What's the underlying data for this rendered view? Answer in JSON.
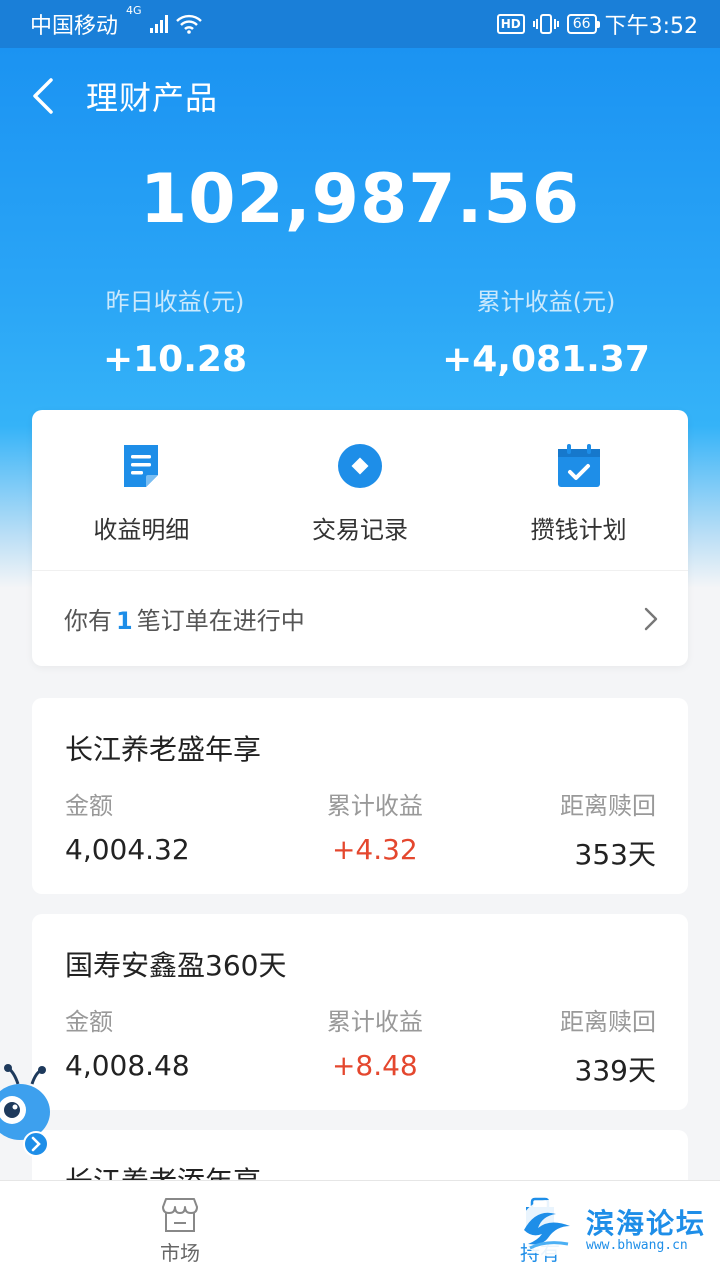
{
  "status_bar": {
    "carrier": "中国移动",
    "network": "4G",
    "hd": "HD",
    "battery": "66",
    "time": "下午3:52"
  },
  "header": {
    "title": "理财产品",
    "total_amount": "102,987.56",
    "yesterday_label": "昨日收益(元)",
    "yesterday_value": "+10.28",
    "cumulative_label": "累计收益(元)",
    "cumulative_value": "+4,081.37"
  },
  "menu": {
    "items": [
      {
        "label": "收益明细",
        "icon": "document-icon"
      },
      {
        "label": "交易记录",
        "icon": "coin-icon"
      },
      {
        "label": "攒钱计划",
        "icon": "calendar-check-icon"
      }
    ],
    "order_prefix": "你有",
    "order_count": "1",
    "order_suffix": "笔订单在进行中"
  },
  "products": [
    {
      "name": "长江养老盛年享",
      "amount_label": "金额",
      "amount": "4,004.32",
      "profit_label": "累计收益",
      "profit": "+4.32",
      "redeem_label": "距离赎回",
      "redeem": "353天"
    },
    {
      "name": "国寿安鑫盈360天",
      "amount_label": "金额",
      "amount": "4,008.48",
      "profit_label": "累计收益",
      "profit": "+8.48",
      "redeem_label": "距离赎回",
      "redeem": "339天"
    }
  ],
  "partial_product": {
    "name": "长江养老添年享"
  },
  "tabs": [
    {
      "label": "市场",
      "icon": "store-icon"
    },
    {
      "label": "持有",
      "icon": "holdings-icon"
    }
  ],
  "watermark": {
    "text": "滨海论坛",
    "url": "www.bhwang.cn"
  },
  "colors": {
    "primary": "#1e8ee8",
    "profit": "#e4472e",
    "header_gradient_top": "#1b93f2"
  }
}
